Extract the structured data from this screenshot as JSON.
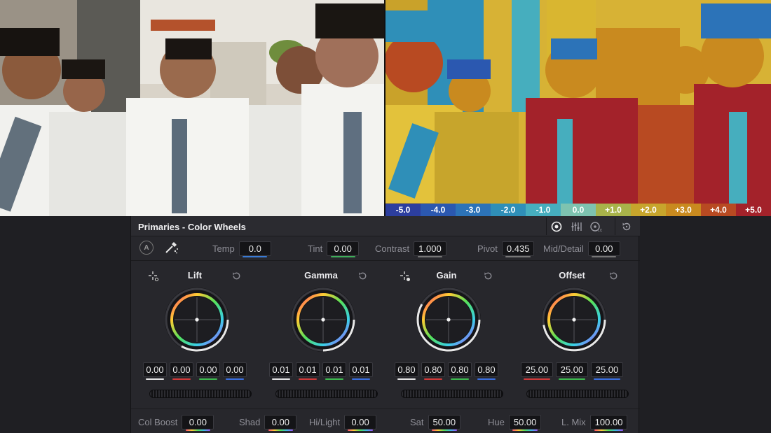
{
  "scale_labels": [
    "-5.0",
    "-4.0",
    "-3.0",
    "-2.0",
    "-1.0",
    "0.0",
    "+1.0",
    "+2.0",
    "+3.0",
    "+4.0",
    "+5.0"
  ],
  "scale_colors": [
    "#2c3e9e",
    "#2b58b0",
    "#2c73b8",
    "#2f8fb8",
    "#46aebe",
    "#7ec3b0",
    "#a8b34a",
    "#c7a52c",
    "#c98a1f",
    "#b84a22",
    "#a3222a"
  ],
  "panel": {
    "title": "Primaries - Color Wheels",
    "auto_label": "A",
    "top_params": [
      {
        "label": "Temp",
        "value": "0.0",
        "under": "#3a7bd5"
      },
      {
        "label": "Tint",
        "value": "0.00",
        "under": "#3fae5a"
      },
      {
        "label": "Contrast",
        "value": "1.000",
        "under": "#777777"
      },
      {
        "label": "Pivot",
        "value": "0.435",
        "under": "#777777"
      },
      {
        "label": "Mid/Detail",
        "value": "0.00",
        "under": "#777777"
      }
    ],
    "wheels": [
      {
        "name": "Lift",
        "values": [
          "0.00",
          "0.00",
          "0.00",
          "0.00"
        ]
      },
      {
        "name": "Gamma",
        "values": [
          "0.01",
          "0.01",
          "0.01",
          "0.01"
        ]
      },
      {
        "name": "Gain",
        "values": [
          "0.80",
          "0.80",
          "0.80",
          "0.80"
        ]
      },
      {
        "name": "Offset",
        "values": [
          "25.00",
          "25.00",
          "25.00"
        ]
      }
    ],
    "bottom_params": [
      {
        "label": "Col Boost",
        "value": "0.00"
      },
      {
        "label": "Shad",
        "value": "0.00"
      },
      {
        "label": "Hi/Light",
        "value": "0.00"
      },
      {
        "label": "Sat",
        "value": "50.00"
      },
      {
        "label": "Hue",
        "value": "50.00"
      },
      {
        "label": "L. Mix",
        "value": "100.00"
      }
    ]
  }
}
